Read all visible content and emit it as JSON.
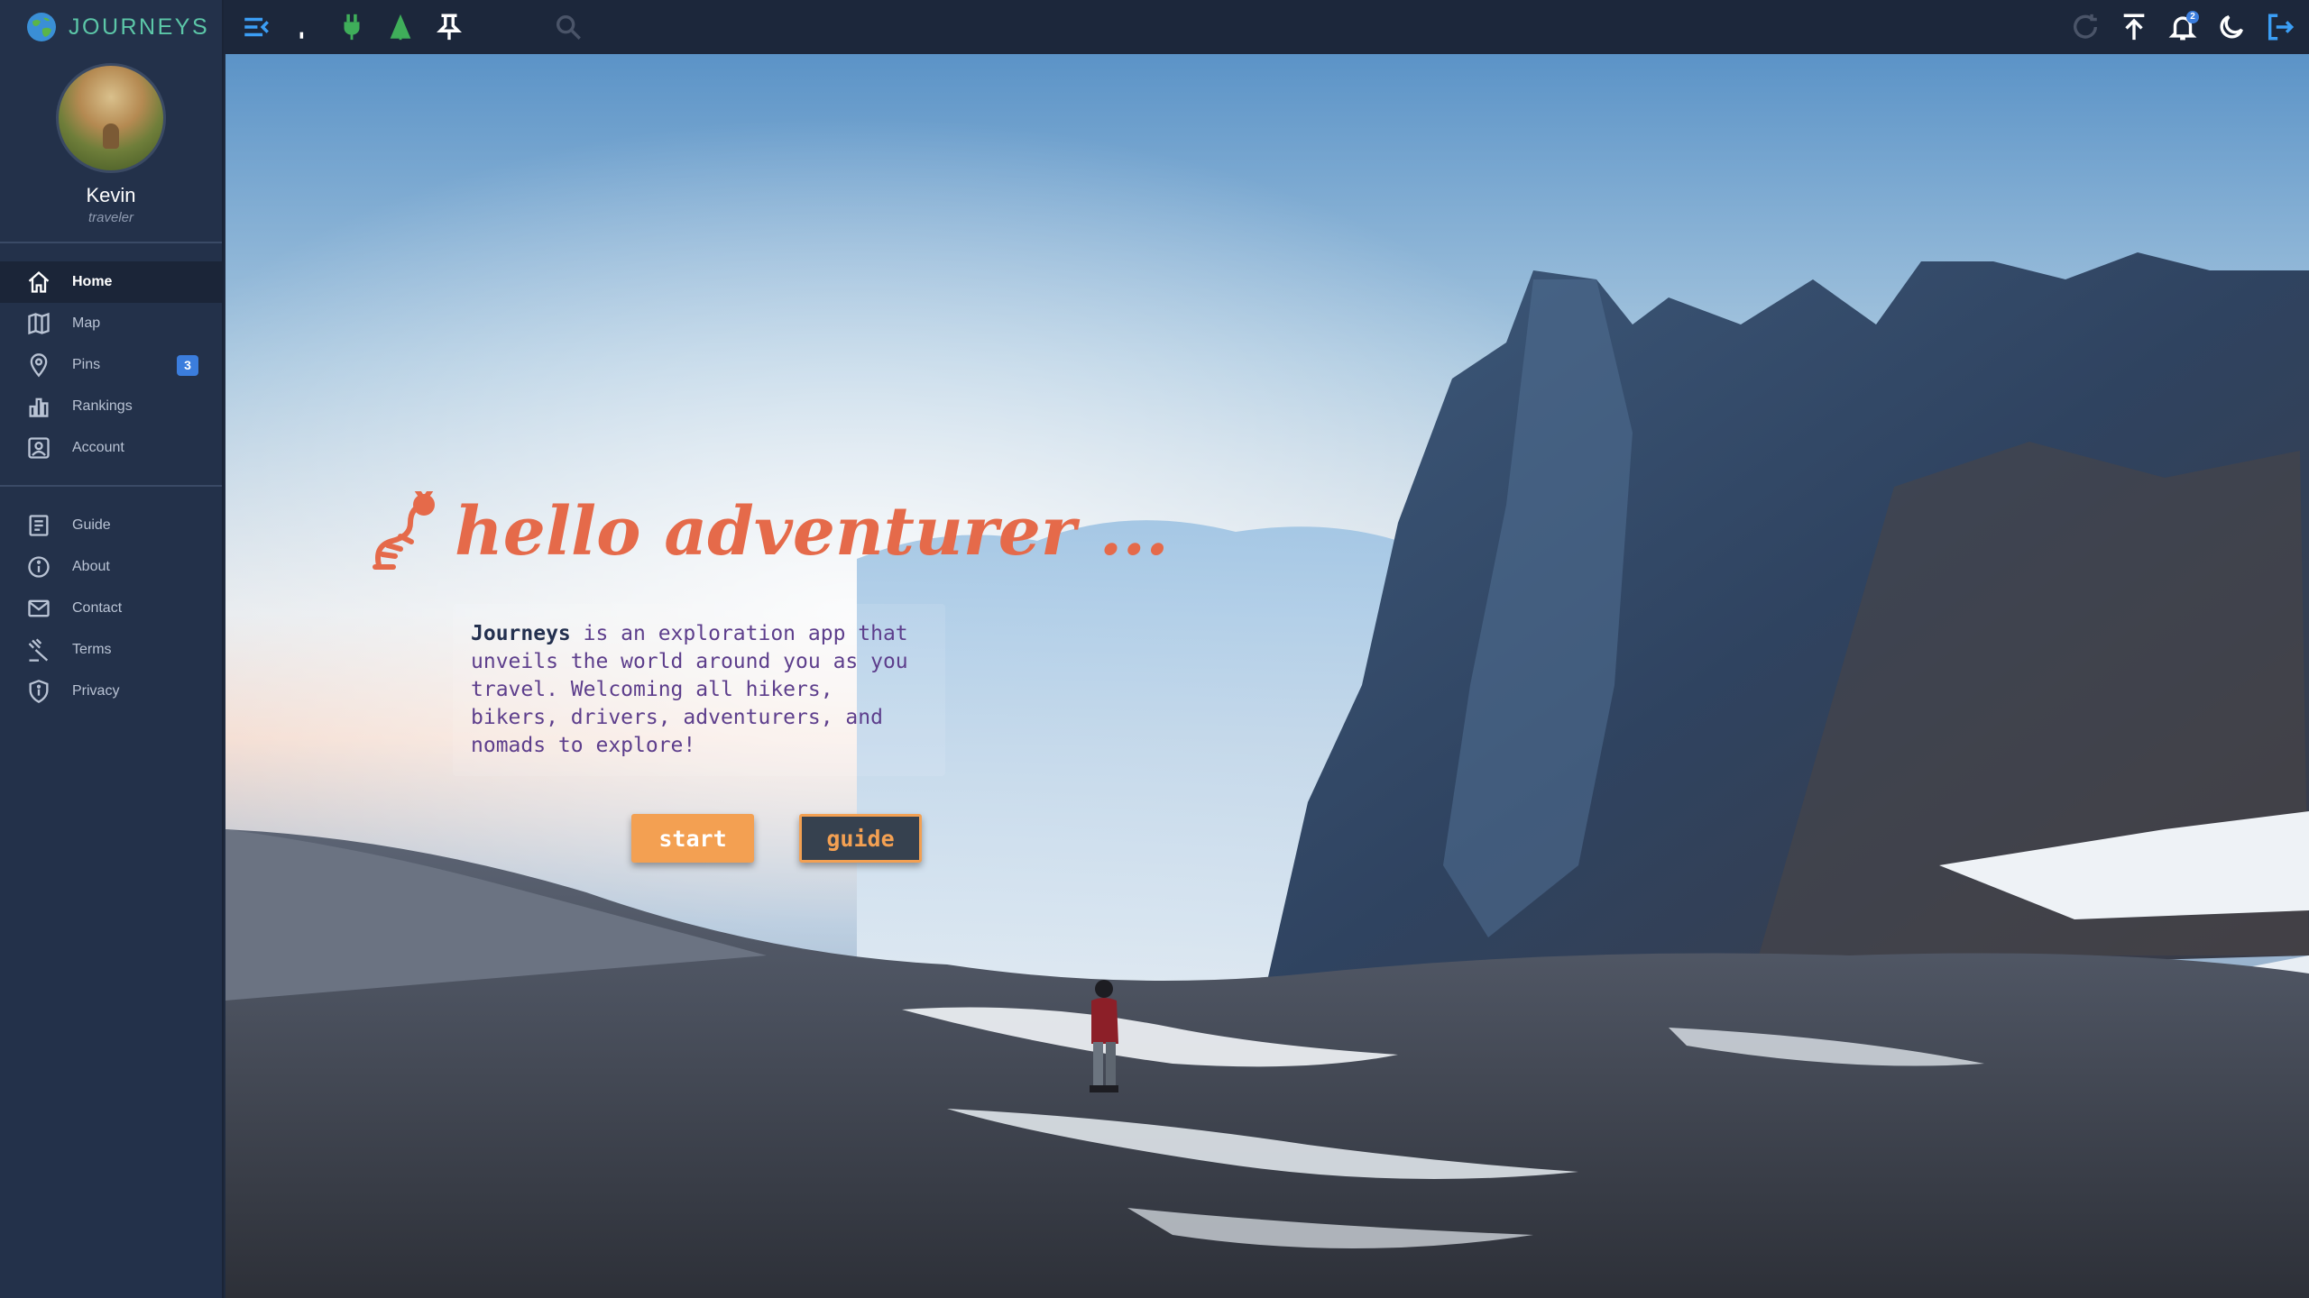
{
  "app": {
    "name": "JOURNEYS"
  },
  "profile": {
    "name": "Kevin",
    "role": "traveler"
  },
  "nav_main": [
    {
      "label": "Home",
      "icon": "home-icon",
      "active": true
    },
    {
      "label": "Map",
      "icon": "map-icon"
    },
    {
      "label": "Pins",
      "icon": "pin-icon",
      "badge": "3"
    },
    {
      "label": "Rankings",
      "icon": "rankings-icon"
    },
    {
      "label": "Account",
      "icon": "account-icon"
    }
  ],
  "nav_info": [
    {
      "label": "Guide",
      "icon": "guide-icon"
    },
    {
      "label": "About",
      "icon": "info-icon"
    },
    {
      "label": "Contact",
      "icon": "mail-icon"
    },
    {
      "label": "Terms",
      "icon": "gavel-icon"
    },
    {
      "label": "Privacy",
      "icon": "shield-icon"
    }
  ],
  "topbar": {
    "icons_left": [
      "menu-collapse-icon",
      "plug-icon",
      "tree-icon",
      "push-pin-icon",
      "search-icon"
    ],
    "icons_right": [
      "refresh-icon",
      "upload-icon",
      "bell-icon",
      "moon-icon",
      "logout-icon"
    ],
    "notifications_count": "2"
  },
  "hero": {
    "greeting": "hello adventurer ...",
    "intro_brand": "Journeys",
    "intro_text": " is an exploration app that unveils the world around you as you travel. Welcoming all hikers, bikers, drivers, adventurers, and nomads to explore!",
    "start_label": "start",
    "guide_label": "guide"
  },
  "colors": {
    "accent_orange": "#f3a052",
    "greeting_coral": "#e56a4a",
    "brand_teal": "#5cc7a8",
    "badge_blue": "#3b7ddd",
    "sidebar_bg": "#23314a"
  }
}
